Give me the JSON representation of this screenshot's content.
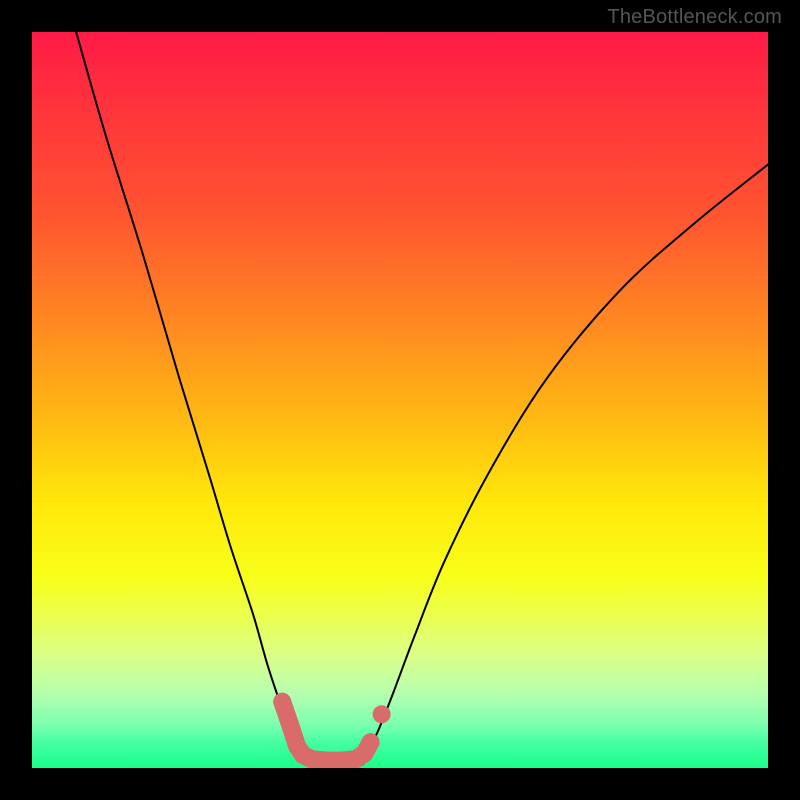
{
  "watermark": "TheBottleneck.com",
  "chart_data": {
    "type": "line",
    "title": "",
    "xlabel": "",
    "ylabel": "",
    "xlim": [
      0,
      100
    ],
    "ylim": [
      0,
      100
    ],
    "series": [
      {
        "name": "left-branch",
        "x": [
          6,
          10,
          15,
          20,
          24,
          27,
          30,
          32,
          34,
          35.5,
          37
        ],
        "y": [
          100,
          86,
          70,
          53,
          40,
          30,
          21,
          14,
          8,
          4,
          1
        ]
      },
      {
        "name": "right-branch",
        "x": [
          45,
          47,
          49,
          52,
          56,
          62,
          70,
          80,
          90,
          100
        ],
        "y": [
          1,
          5,
          10,
          18,
          28,
          40,
          53,
          65,
          74,
          82
        ]
      },
      {
        "name": "valley-floor",
        "x": [
          37,
          40,
          43,
          45
        ],
        "y": [
          0.5,
          0.3,
          0.3,
          0.5
        ]
      }
    ],
    "markers": [
      {
        "name": "left-cluster-1",
        "x": 34.0,
        "y": 9.0
      },
      {
        "name": "left-cluster-2",
        "x": 35.2,
        "y": 5.5
      },
      {
        "name": "left-cluster-3",
        "x": 36.0,
        "y": 3.0
      },
      {
        "name": "left-cluster-4",
        "x": 36.8,
        "y": 1.8
      },
      {
        "name": "floor-1",
        "x": 38.0,
        "y": 1.2
      },
      {
        "name": "floor-2",
        "x": 40.0,
        "y": 1.0
      },
      {
        "name": "floor-3",
        "x": 42.0,
        "y": 1.0
      },
      {
        "name": "floor-4",
        "x": 44.0,
        "y": 1.2
      },
      {
        "name": "right-cluster-1",
        "x": 45.2,
        "y": 2.0
      },
      {
        "name": "right-cluster-2",
        "x": 46.0,
        "y": 3.5
      },
      {
        "name": "right-gap-1",
        "x": 47.5,
        "y": 7.3
      }
    ],
    "colors": {
      "curve": "#000000",
      "marker": "#d96b6b",
      "gradient_top": "#ff1a47",
      "gradient_mid": "#ffe80a",
      "gradient_bottom": "#1aff8a"
    }
  }
}
